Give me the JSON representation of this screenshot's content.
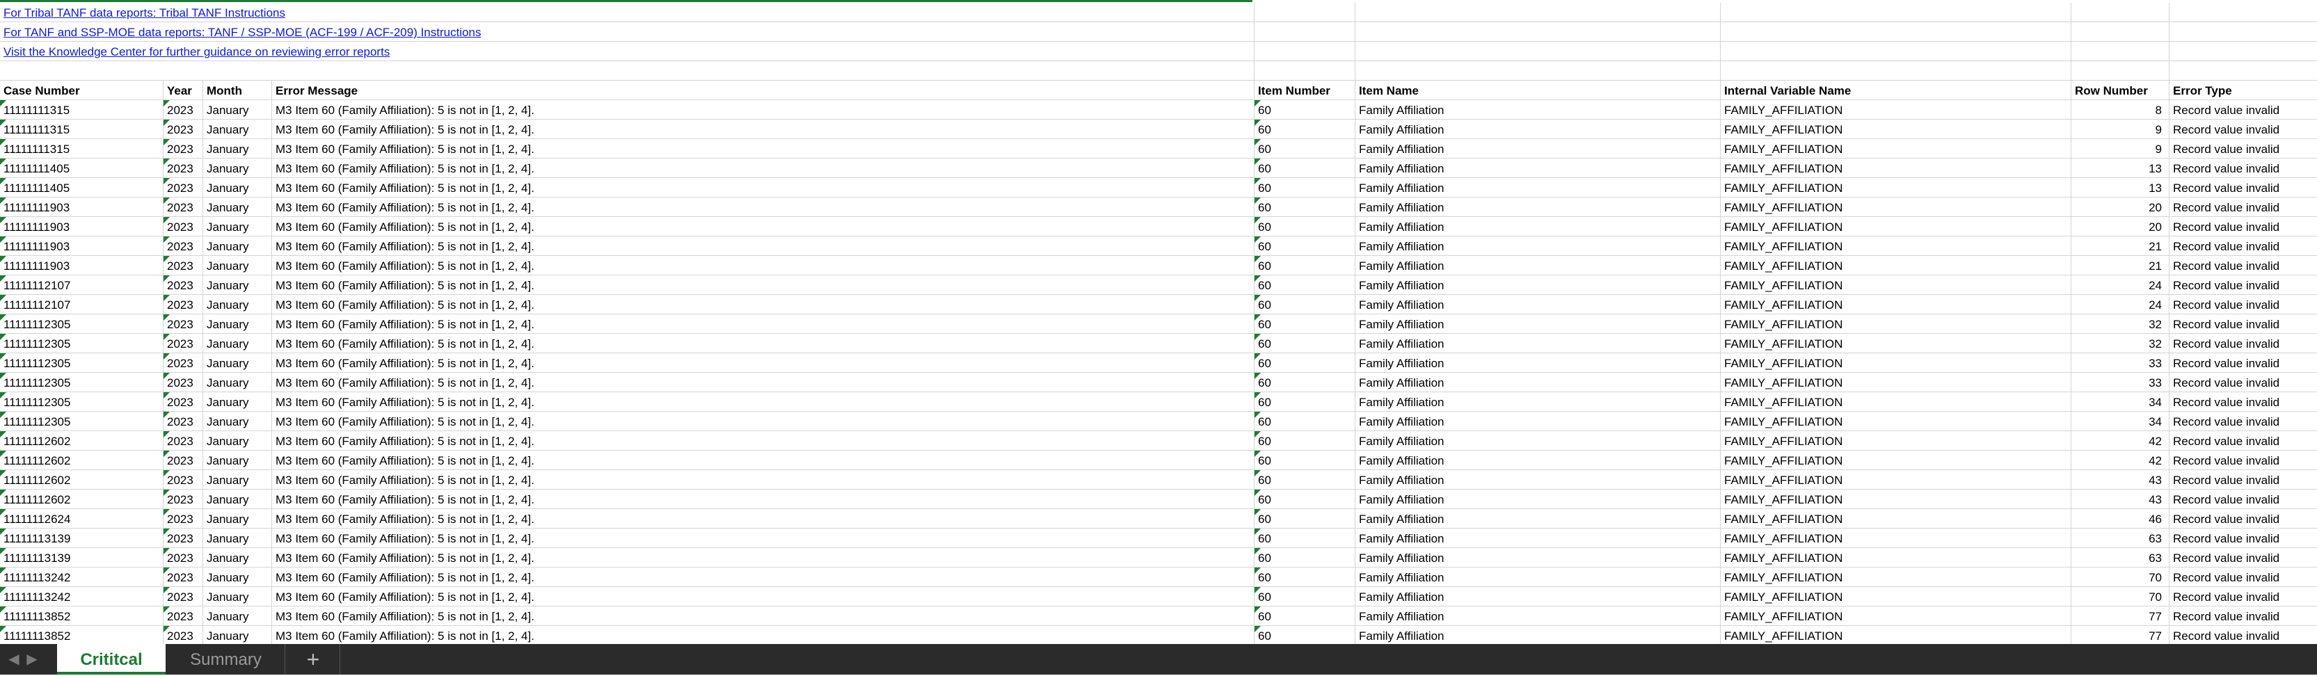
{
  "links": [
    "For Tribal TANF data reports: Tribal TANF Instructions",
    "For TANF and SSP-MOE data reports: TANF / SSP-MOE (ACF-199 / ACF-209) Instructions",
    "Visit the Knowledge Center for further guidance on reviewing error reports"
  ],
  "headers": [
    "Case Number",
    "Year",
    "Month",
    "Error Message",
    "Item Number",
    "Item Name",
    "Internal Variable Name",
    "Row Number",
    "Error Type"
  ],
  "rows": [
    [
      "11111111315",
      "2023",
      "January",
      "M3 Item 60 (Family Affiliation): 5 is not in [1, 2, 4].",
      "60",
      "Family Affiliation",
      "FAMILY_AFFILIATION",
      "8",
      "Record value invalid"
    ],
    [
      "11111111315",
      "2023",
      "January",
      "M3 Item 60 (Family Affiliation): 5 is not in [1, 2, 4].",
      "60",
      "Family Affiliation",
      "FAMILY_AFFILIATION",
      "9",
      "Record value invalid"
    ],
    [
      "11111111315",
      "2023",
      "January",
      "M3 Item 60 (Family Affiliation): 5 is not in [1, 2, 4].",
      "60",
      "Family Affiliation",
      "FAMILY_AFFILIATION",
      "9",
      "Record value invalid"
    ],
    [
      "11111111405",
      "2023",
      "January",
      "M3 Item 60 (Family Affiliation): 5 is not in [1, 2, 4].",
      "60",
      "Family Affiliation",
      "FAMILY_AFFILIATION",
      "13",
      "Record value invalid"
    ],
    [
      "11111111405",
      "2023",
      "January",
      "M3 Item 60 (Family Affiliation): 5 is not in [1, 2, 4].",
      "60",
      "Family Affiliation",
      "FAMILY_AFFILIATION",
      "13",
      "Record value invalid"
    ],
    [
      "11111111903",
      "2023",
      "January",
      "M3 Item 60 (Family Affiliation): 5 is not in [1, 2, 4].",
      "60",
      "Family Affiliation",
      "FAMILY_AFFILIATION",
      "20",
      "Record value invalid"
    ],
    [
      "11111111903",
      "2023",
      "January",
      "M3 Item 60 (Family Affiliation): 5 is not in [1, 2, 4].",
      "60",
      "Family Affiliation",
      "FAMILY_AFFILIATION",
      "20",
      "Record value invalid"
    ],
    [
      "11111111903",
      "2023",
      "January",
      "M3 Item 60 (Family Affiliation): 5 is not in [1, 2, 4].",
      "60",
      "Family Affiliation",
      "FAMILY_AFFILIATION",
      "21",
      "Record value invalid"
    ],
    [
      "11111111903",
      "2023",
      "January",
      "M3 Item 60 (Family Affiliation): 5 is not in [1, 2, 4].",
      "60",
      "Family Affiliation",
      "FAMILY_AFFILIATION",
      "21",
      "Record value invalid"
    ],
    [
      "11111112107",
      "2023",
      "January",
      "M3 Item 60 (Family Affiliation): 5 is not in [1, 2, 4].",
      "60",
      "Family Affiliation",
      "FAMILY_AFFILIATION",
      "24",
      "Record value invalid"
    ],
    [
      "11111112107",
      "2023",
      "January",
      "M3 Item 60 (Family Affiliation): 5 is not in [1, 2, 4].",
      "60",
      "Family Affiliation",
      "FAMILY_AFFILIATION",
      "24",
      "Record value invalid"
    ],
    [
      "11111112305",
      "2023",
      "January",
      "M3 Item 60 (Family Affiliation): 5 is not in [1, 2, 4].",
      "60",
      "Family Affiliation",
      "FAMILY_AFFILIATION",
      "32",
      "Record value invalid"
    ],
    [
      "11111112305",
      "2023",
      "January",
      "M3 Item 60 (Family Affiliation): 5 is not in [1, 2, 4].",
      "60",
      "Family Affiliation",
      "FAMILY_AFFILIATION",
      "32",
      "Record value invalid"
    ],
    [
      "11111112305",
      "2023",
      "January",
      "M3 Item 60 (Family Affiliation): 5 is not in [1, 2, 4].",
      "60",
      "Family Affiliation",
      "FAMILY_AFFILIATION",
      "33",
      "Record value invalid"
    ],
    [
      "11111112305",
      "2023",
      "January",
      "M3 Item 60 (Family Affiliation): 5 is not in [1, 2, 4].",
      "60",
      "Family Affiliation",
      "FAMILY_AFFILIATION",
      "33",
      "Record value invalid"
    ],
    [
      "11111112305",
      "2023",
      "January",
      "M3 Item 60 (Family Affiliation): 5 is not in [1, 2, 4].",
      "60",
      "Family Affiliation",
      "FAMILY_AFFILIATION",
      "34",
      "Record value invalid"
    ],
    [
      "11111112305",
      "2023",
      "January",
      "M3 Item 60 (Family Affiliation): 5 is not in [1, 2, 4].",
      "60",
      "Family Affiliation",
      "FAMILY_AFFILIATION",
      "34",
      "Record value invalid"
    ],
    [
      "11111112602",
      "2023",
      "January",
      "M3 Item 60 (Family Affiliation): 5 is not in [1, 2, 4].",
      "60",
      "Family Affiliation",
      "FAMILY_AFFILIATION",
      "42",
      "Record value invalid"
    ],
    [
      "11111112602",
      "2023",
      "January",
      "M3 Item 60 (Family Affiliation): 5 is not in [1, 2, 4].",
      "60",
      "Family Affiliation",
      "FAMILY_AFFILIATION",
      "42",
      "Record value invalid"
    ],
    [
      "11111112602",
      "2023",
      "January",
      "M3 Item 60 (Family Affiliation): 5 is not in [1, 2, 4].",
      "60",
      "Family Affiliation",
      "FAMILY_AFFILIATION",
      "43",
      "Record value invalid"
    ],
    [
      "11111112602",
      "2023",
      "January",
      "M3 Item 60 (Family Affiliation): 5 is not in [1, 2, 4].",
      "60",
      "Family Affiliation",
      "FAMILY_AFFILIATION",
      "43",
      "Record value invalid"
    ],
    [
      "11111112624",
      "2023",
      "January",
      "M3 Item 60 (Family Affiliation): 5 is not in [1, 2, 4].",
      "60",
      "Family Affiliation",
      "FAMILY_AFFILIATION",
      "46",
      "Record value invalid"
    ],
    [
      "11111113139",
      "2023",
      "January",
      "M3 Item 60 (Family Affiliation): 5 is not in [1, 2, 4].",
      "60",
      "Family Affiliation",
      "FAMILY_AFFILIATION",
      "63",
      "Record value invalid"
    ],
    [
      "11111113139",
      "2023",
      "January",
      "M3 Item 60 (Family Affiliation): 5 is not in [1, 2, 4].",
      "60",
      "Family Affiliation",
      "FAMILY_AFFILIATION",
      "63",
      "Record value invalid"
    ],
    [
      "11111113242",
      "2023",
      "January",
      "M3 Item 60 (Family Affiliation): 5 is not in [1, 2, 4].",
      "60",
      "Family Affiliation",
      "FAMILY_AFFILIATION",
      "70",
      "Record value invalid"
    ],
    [
      "11111113242",
      "2023",
      "January",
      "M3 Item 60 (Family Affiliation): 5 is not in [1, 2, 4].",
      "60",
      "Family Affiliation",
      "FAMILY_AFFILIATION",
      "70",
      "Record value invalid"
    ],
    [
      "11111113852",
      "2023",
      "January",
      "M3 Item 60 (Family Affiliation): 5 is not in [1, 2, 4].",
      "60",
      "Family Affiliation",
      "FAMILY_AFFILIATION",
      "77",
      "Record value invalid"
    ],
    [
      "11111113852",
      "2023",
      "January",
      "M3 Item 60 (Family Affiliation): 5 is not in [1, 2, 4].",
      "60",
      "Family Affiliation",
      "FAMILY_AFFILIATION",
      "77",
      "Record value invalid"
    ]
  ],
  "tabs": {
    "active": "Crititcal",
    "inactive": "Summary",
    "add": "+",
    "nav_prev_icon": "◀",
    "nav_next_icon": "▶"
  },
  "colors": {
    "accent": "#1e7b34",
    "link": "#0a1bdc",
    "tabbar": "#2b2b2b"
  }
}
